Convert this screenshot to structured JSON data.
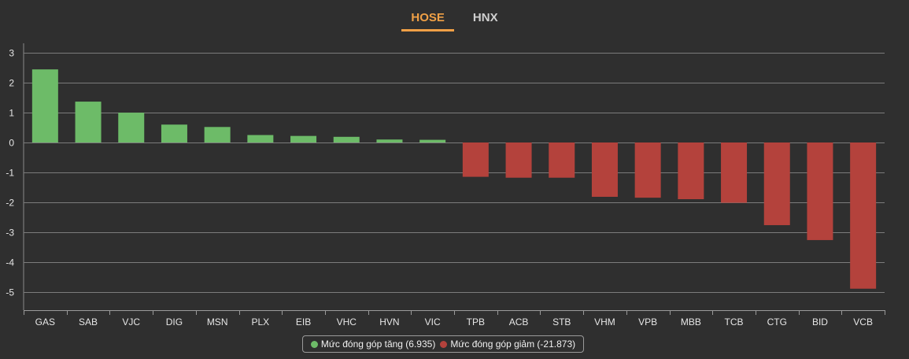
{
  "tabs": [
    {
      "label": "HOSE",
      "active": true
    },
    {
      "label": "HNX",
      "active": false
    }
  ],
  "colors": {
    "increase": "#6dbb68",
    "decrease": "#b4423c",
    "active_tab": "#f0a046",
    "background": "#2f2f2f",
    "grid": "#8a8a8a"
  },
  "legend": {
    "increase_label": "Mức đóng góp tăng (6.935)",
    "decrease_label": "Mức đóng góp giảm (-21.873)"
  },
  "chart_data": {
    "type": "bar",
    "categories": [
      "GAS",
      "SAB",
      "VJC",
      "DIG",
      "MSN",
      "PLX",
      "EIB",
      "VHC",
      "HVN",
      "VIC",
      "TPB",
      "ACB",
      "STB",
      "VHM",
      "VPB",
      "MBB",
      "TCB",
      "CTG",
      "BID",
      "VCB"
    ],
    "values": [
      2.45,
      1.37,
      1.0,
      0.6,
      0.52,
      0.25,
      0.22,
      0.19,
      0.1,
      0.09,
      -1.15,
      -1.18,
      -1.18,
      -1.82,
      -1.85,
      -1.9,
      -2.02,
      -2.77,
      -3.27,
      -4.9
    ],
    "ylim": [
      -5.6,
      3.3
    ],
    "yticks": [
      3,
      2,
      1,
      0,
      -1,
      -2,
      -3,
      -4,
      -5
    ],
    "grid": true,
    "legend_position": "bottom-center"
  }
}
